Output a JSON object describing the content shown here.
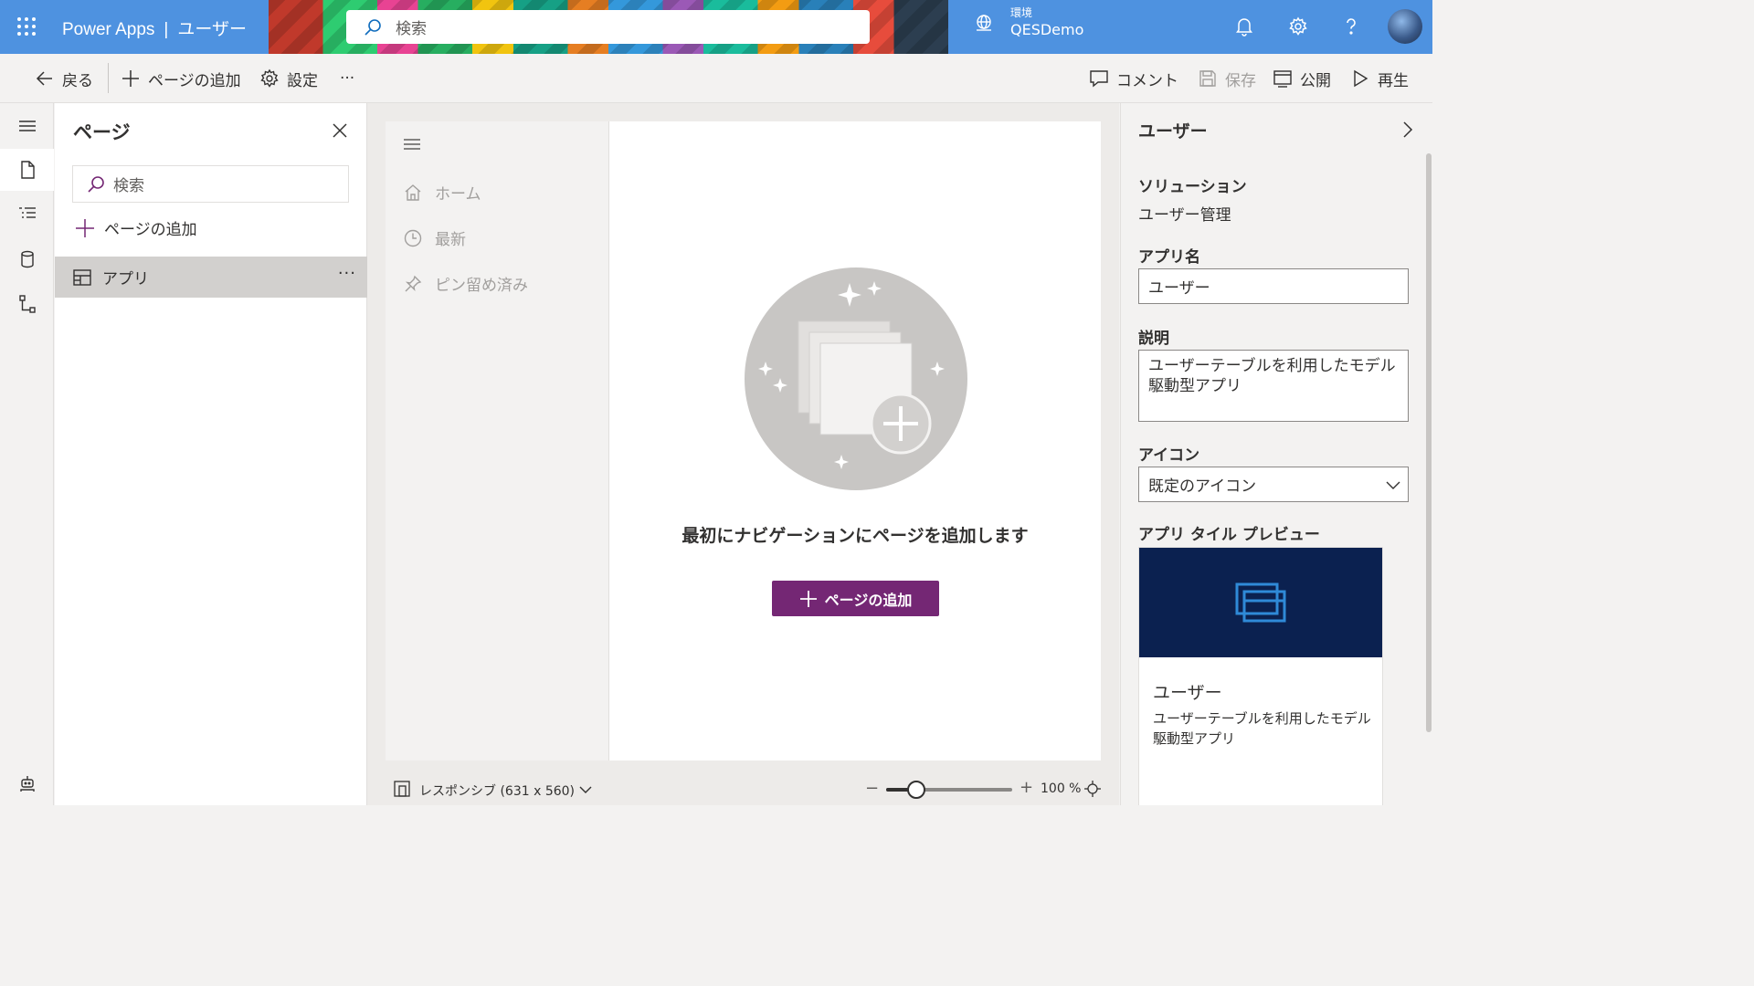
{
  "topbar": {
    "product": "Power Apps",
    "separator": "|",
    "app_name": "ユーザー",
    "search_placeholder": "検索",
    "env_label": "環境",
    "env_value": "QESDemo"
  },
  "commandbar": {
    "back": "戻る",
    "add_page": "ページの追加",
    "settings": "設定",
    "more": "···",
    "comment": "コメント",
    "save": "保存",
    "publish": "公開",
    "play": "再生"
  },
  "pages_panel": {
    "title": "ページ",
    "search_placeholder": "検索",
    "add_page": "ページの追加",
    "items": [
      {
        "label": "アプリ",
        "more": "···"
      }
    ]
  },
  "preview": {
    "nav": [
      {
        "label": "ホーム",
        "icon": "home-icon"
      },
      {
        "label": "最新",
        "icon": "clock-icon"
      },
      {
        "label": "ピン留め済み",
        "icon": "pin-icon"
      }
    ],
    "empty_message": "最初にナビゲーションにページを追加します",
    "add_button": "ページの追加"
  },
  "statusbar": {
    "responsive": "レスポンシブ (631 x 560)",
    "zoom_minus": "−",
    "zoom_plus": "+",
    "zoom_value": "100 %",
    "zoom_level": 0.24
  },
  "properties": {
    "title": "ユーザー",
    "solution_label": "ソリューション",
    "solution_value": "ユーザー管理",
    "app_name_label": "アプリ名",
    "app_name_value": "ユーザー",
    "description_label": "説明",
    "description_value": "ユーザーテーブルを利用したモデル駆動型アプリ",
    "icon_label": "アイコン",
    "icon_value": "既定のアイコン",
    "tile_preview_label": "アプリ タイル プレビュー",
    "tile_name": "ユーザー",
    "tile_description": "ユーザーテーブルを利用したモデル駆動型アプリ"
  },
  "colors": {
    "brand": "#742774",
    "topbar": "#4e92e0",
    "tile_bg": "#0b2150"
  }
}
